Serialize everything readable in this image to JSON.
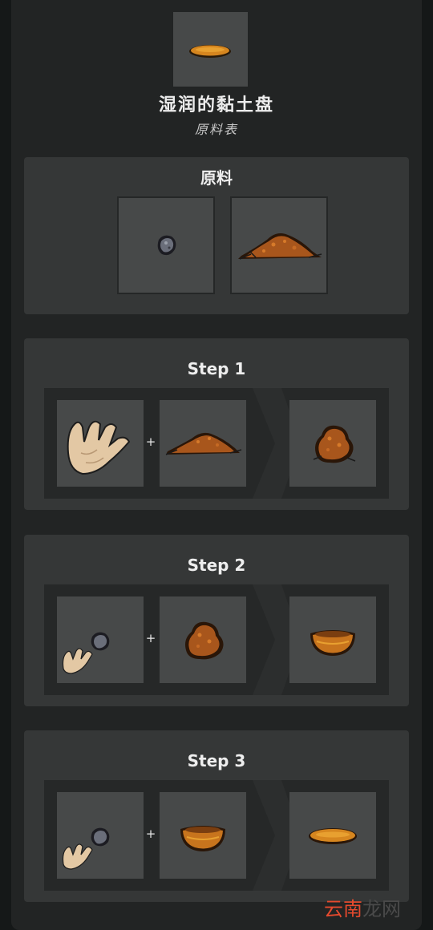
{
  "item": {
    "title": "湿润的黏土盘",
    "subtitle": "原料表",
    "icon": "clay-plate-icon"
  },
  "ingredients": {
    "title": "原料",
    "items": [
      {
        "icon": "stone-icon"
      },
      {
        "icon": "dirt-pile-icon"
      }
    ]
  },
  "steps": [
    {
      "title": "Step 1",
      "inputs": [
        {
          "icon": "hand-icon"
        },
        {
          "icon": "dirt-pile-icon"
        }
      ],
      "plus": "+",
      "output": {
        "icon": "clay-lump-icon"
      }
    },
    {
      "title": "Step 2",
      "inputs": [
        {
          "icon": "stone-with-hand-icon"
        },
        {
          "icon": "clay-lump-icon"
        }
      ],
      "plus": "+",
      "output": {
        "icon": "clay-bowl-icon"
      }
    },
    {
      "title": "Step 3",
      "inputs": [
        {
          "icon": "stone-with-hand-icon"
        },
        {
          "icon": "clay-bowl-icon"
        }
      ],
      "plus": "+",
      "output": {
        "icon": "clay-plate-icon"
      }
    }
  ],
  "watermark": {
    "accent": "云南",
    "dark": "龙网"
  },
  "colors": {
    "page_bg": "#151818",
    "panel_bg": "#222424",
    "section_bg": "#353737",
    "slot_bg": "#474949",
    "clay": "#c8741d",
    "watermark_red": "#e44a2e"
  }
}
